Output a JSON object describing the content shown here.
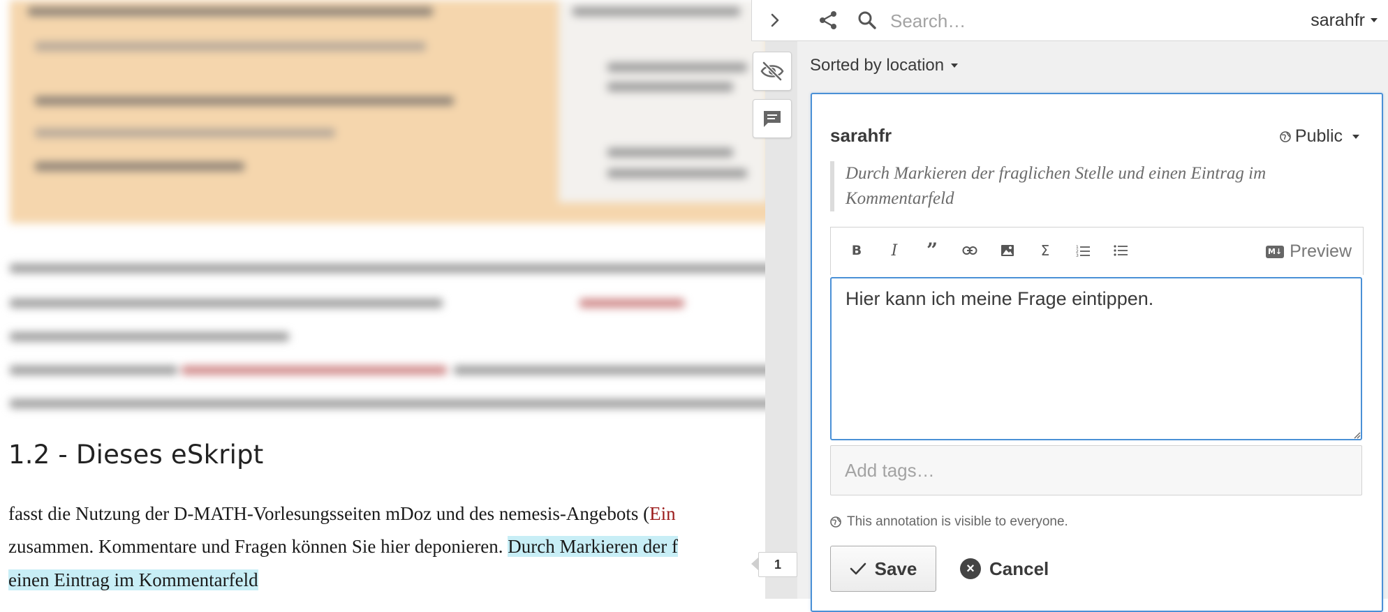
{
  "topbar": {
    "search_placeholder": "Search…",
    "user": "sarahfr"
  },
  "sort": {
    "label": "Sorted by location"
  },
  "annotation": {
    "username": "sarahfr",
    "privacy": "Public",
    "quote": "Durch Markieren der fraglichen Stelle und einen Eintrag im Kommentarfeld",
    "toolbar": {
      "items": [
        "bold-icon",
        "italic-icon",
        "quote-icon",
        "link-icon",
        "image-icon",
        "math-icon",
        "numbered-list-icon",
        "bullet-list-icon"
      ],
      "preview_label": "Preview",
      "markdown_badge": "M↓"
    },
    "text": "Hier kann ich meine Frage eintippen.",
    "tags_placeholder": "Add tags…",
    "visibility_note": "This annotation is visible to everyone.",
    "save_label": "Save",
    "cancel_label": "Cancel"
  },
  "document": {
    "heading": "1.2 - Dieses eSkript",
    "line1_a": "fasst die Nutzung der D-MATH-Vorlesungsseiten mDoz und des nemesis-Angebots (",
    "line1_b": "Ein",
    "line2_a": "zusammen. Kommentare und Fragen können Sie hier deponieren. ",
    "line2_b": "Durch Markieren der f",
    "line3": "einen Eintrag im Kommentarfeld"
  },
  "bucket": {
    "count": "1"
  },
  "colors": {
    "accent": "#4a90d6",
    "highlight": "#c8eef6",
    "blurred_box": "#f5d6ad"
  }
}
